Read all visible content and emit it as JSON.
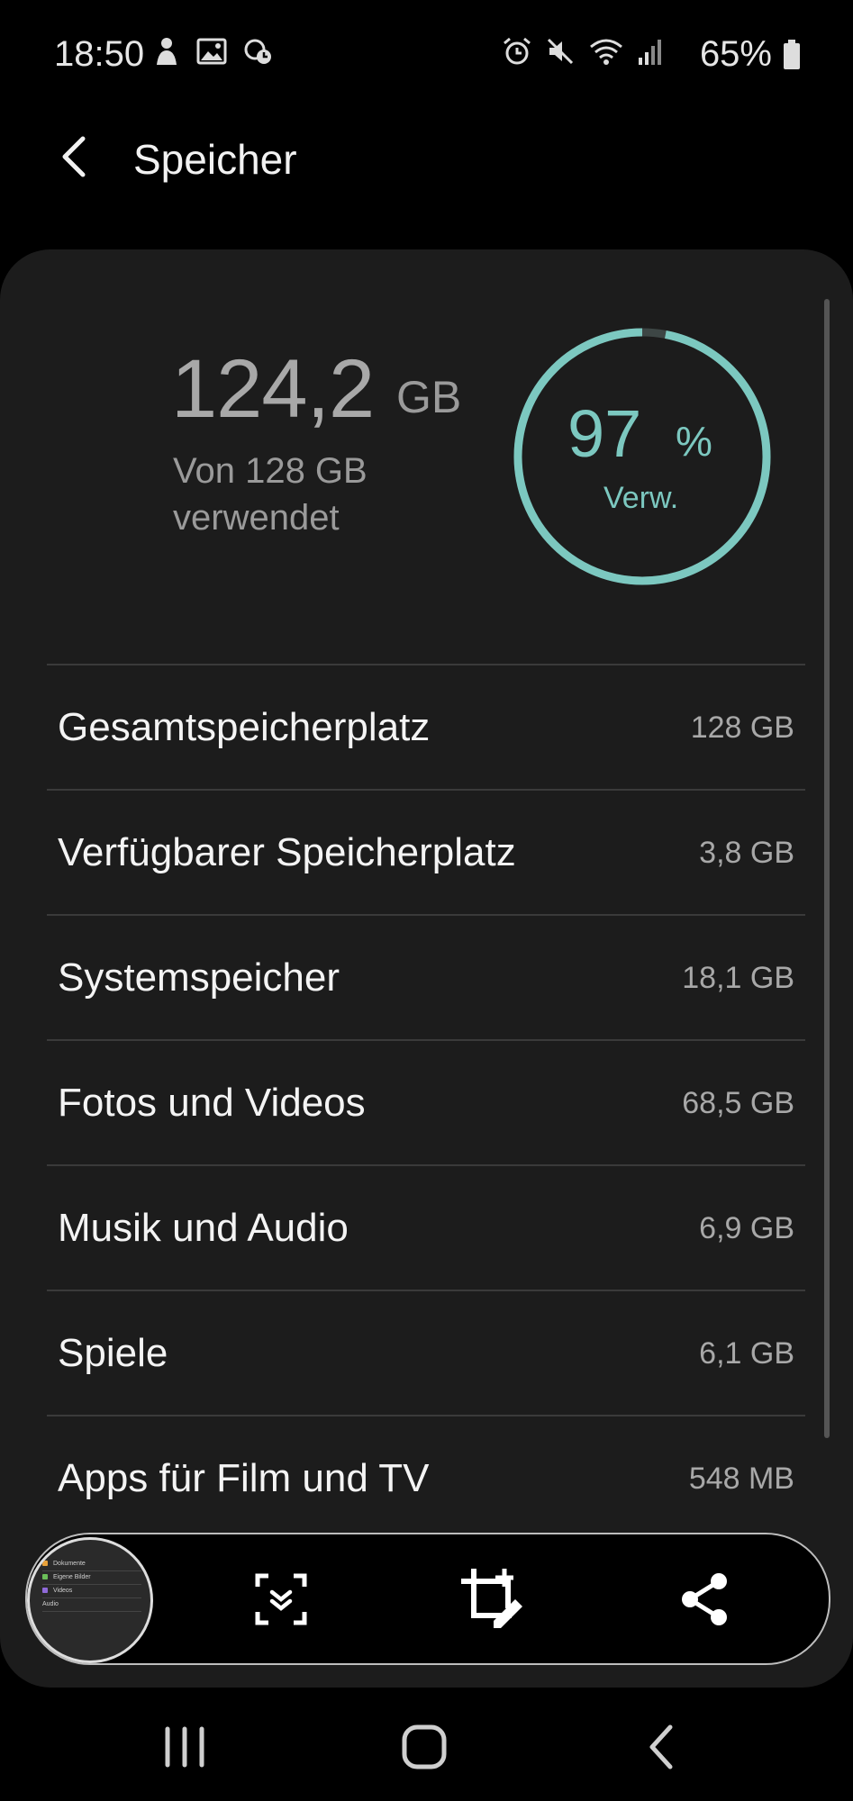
{
  "status_bar": {
    "time": "18:50",
    "battery_pct": "65%",
    "left_icons": [
      "notification-person-icon",
      "image-icon",
      "clock-sync-icon"
    ],
    "right_icons": [
      "alarm-icon",
      "mute-icon",
      "wifi-icon",
      "signal-icon",
      "battery-icon"
    ]
  },
  "app_bar": {
    "title": "Speicher"
  },
  "summary": {
    "used_value": "124,2",
    "used_unit": "GB",
    "used_caption": "Von 128 GB verwendet",
    "percent": "97",
    "percent_sign": "%",
    "percent_label": "Verw.",
    "percent_fraction": 0.97,
    "accent_color": "#7cc8c0"
  },
  "storage_items": [
    {
      "label": "Gesamtspeicherplatz",
      "value": "128 GB"
    },
    {
      "label": "Verfügbarer Speicherplatz",
      "value": "3,8 GB"
    },
    {
      "label": "Systemspeicher",
      "value": "18,1 GB"
    },
    {
      "label": "Fotos und Videos",
      "value": "68,5 GB"
    },
    {
      "label": "Musik und Audio",
      "value": "6,9 GB"
    },
    {
      "label": "Spiele",
      "value": "6,1 GB"
    },
    {
      "label": "Apps für Film und TV",
      "value": "548 MB"
    }
  ],
  "screenshot_toolbar": {
    "buttons": [
      "scroll-capture-icon",
      "crop-edit-icon",
      "share-icon"
    ],
    "thumbnail_items": [
      "Dokumente",
      "Eigene Bilder",
      "Videos",
      "Audio"
    ]
  },
  "nav_bar": {
    "buttons": [
      "recent-apps-icon",
      "home-icon",
      "back-icon"
    ]
  }
}
